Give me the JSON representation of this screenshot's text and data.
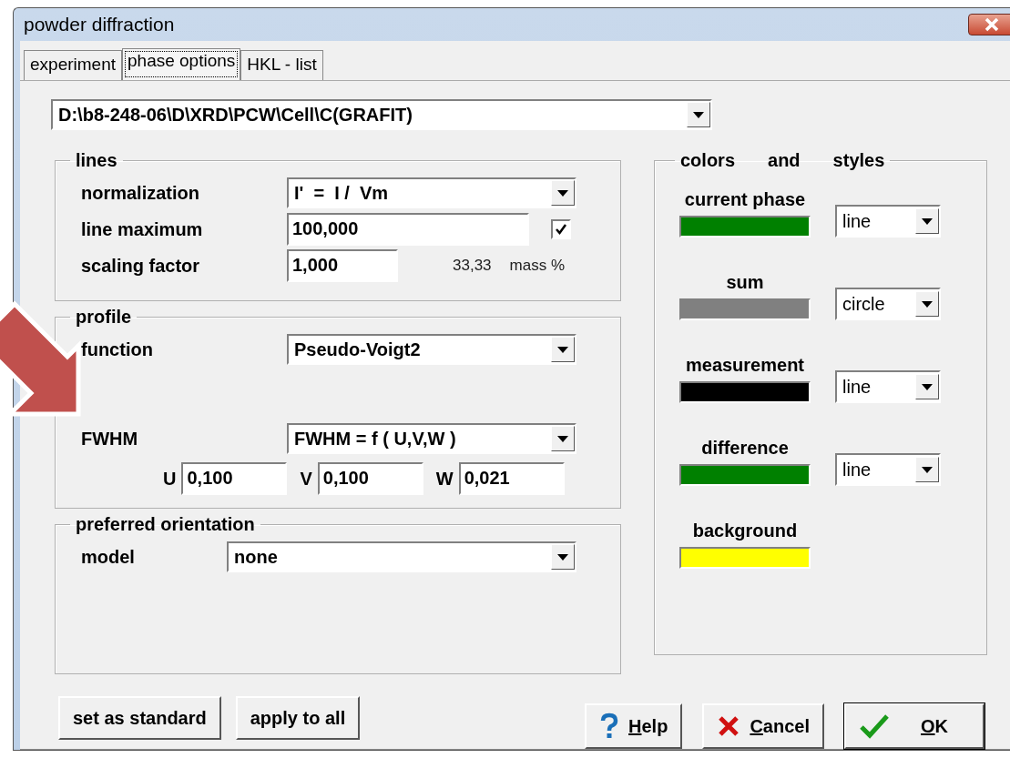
{
  "window": {
    "title": "powder diffraction"
  },
  "tabs": [
    {
      "label": "experiment",
      "selected": false
    },
    {
      "label": "phase options",
      "selected": true
    },
    {
      "label": "HKL - list",
      "selected": false
    }
  ],
  "file_combo": {
    "value": "D:\\b8-248-06\\D\\XRD\\PCW\\Cell\\C(GRAFIT)"
  },
  "lines": {
    "title": "lines",
    "normalization_label": "normalization",
    "normalization_value": "I'  =  I /  Vm",
    "line_maximum_label": "line maximum",
    "line_maximum_value": "100,000",
    "line_maximum_checked": true,
    "scaling_factor_label": "scaling factor",
    "scaling_factor_value": "1,000",
    "mass_value": "33,33",
    "mass_unit": "mass %"
  },
  "profile": {
    "title": "profile",
    "function_label": "function",
    "function_value": "Pseudo-Voigt2",
    "fwhm_label": "FWHM",
    "fwhm_value": "FWHM = f ( U,V,W )",
    "params": [
      {
        "label": "U",
        "value": "0,100"
      },
      {
        "label": "V",
        "value": "0,100"
      },
      {
        "label": "W",
        "value": "0,021"
      }
    ]
  },
  "preferred_orientation": {
    "title": "preferred orientation",
    "model_label": "model",
    "model_value": "none"
  },
  "colors": {
    "title": [
      "colors",
      "and",
      "styles"
    ],
    "items": [
      {
        "label": "current phase",
        "color": "#008000",
        "style": "line"
      },
      {
        "label": "sum",
        "color": "#808080",
        "style": "circle"
      },
      {
        "label": "measurement",
        "color": "#000000",
        "style": "line"
      },
      {
        "label": "difference",
        "color": "#008000",
        "style": "line"
      },
      {
        "label": "background",
        "color": "#ffff00"
      }
    ]
  },
  "buttons": [
    {
      "label": "set as standard",
      "kind": "plain"
    },
    {
      "label": "apply to all",
      "kind": "plain"
    },
    {
      "label": "Help",
      "kind": "help",
      "mnemonic": true
    },
    {
      "label": "Cancel",
      "kind": "cancel",
      "mnemonic": true
    },
    {
      "label": "OK",
      "kind": "ok",
      "mnemonic": true
    }
  ]
}
